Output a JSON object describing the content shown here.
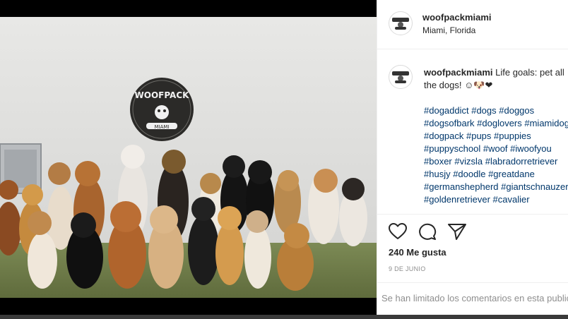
{
  "post": {
    "username": "woofpackmiami",
    "location": "Miami, Florida",
    "caption_text": "Life goals: pet all the dogs! ☺🐶❤",
    "hashtags": [
      "#dogaddict #dogs #doggos",
      "#dogsofbark #doglovers #miamidogs",
      "#dogpack #pups #puppies",
      "#puppyschool #woof #iwoofyou",
      "#boxer #vizsla #labradorretriever",
      "#husjy #doodle #greatdane",
      "#germanshepherd #giantschnauzer",
      "#goldenretriever #cavalier"
    ],
    "likes": "240 Me gusta",
    "date": "9 DE JUNIO",
    "comments_notice": "Se han limitado los comentarios en esta publicación."
  },
  "sign": {
    "line1": "WOOFPACK",
    "line2": "MIAMI"
  },
  "icons": [
    "heart-icon",
    "comment-icon",
    "share-icon"
  ]
}
